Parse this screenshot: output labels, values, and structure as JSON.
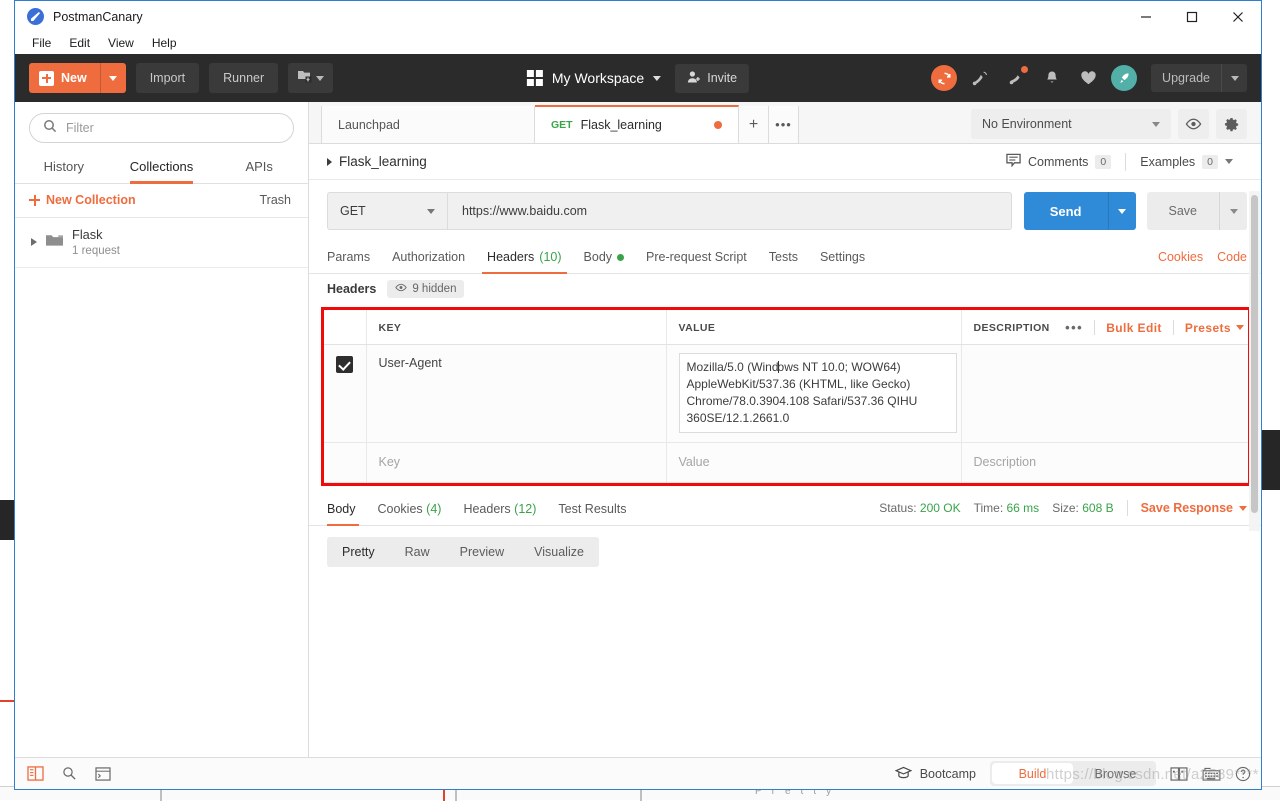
{
  "window": {
    "app_title": "PostmanCanary",
    "logo_icon": "postman-logo-icon",
    "controls": {
      "minimize": "minimize-icon",
      "maximize": "maximize-icon",
      "close": "close-icon"
    }
  },
  "menu": {
    "items": [
      "File",
      "Edit",
      "View",
      "Help"
    ]
  },
  "toolbar": {
    "new_label": "New",
    "import_label": "Import",
    "runner_label": "Runner",
    "package_icon": "new-package-icon",
    "workspace_name": "My Workspace",
    "workspace_icon": "grid-icon",
    "invite_label": "Invite",
    "invite_icon": "invite-person-icon",
    "right_icons": [
      "sync-icon",
      "satellite-icon",
      "notifications-megaphone-icon",
      "bell-icon",
      "heart-icon",
      "rocket-icon"
    ],
    "upgrade_label": "Upgrade",
    "accent_orange": "#ef6c3e",
    "teal": "#52b0a8"
  },
  "sidebar": {
    "filter_placeholder": "Filter",
    "search_icon": "search-icon",
    "tabs": [
      {
        "label": "History",
        "active": false
      },
      {
        "label": "Collections",
        "active": true
      },
      {
        "label": "APIs",
        "active": false
      }
    ],
    "new_collection_label": "New Collection",
    "trash_label": "Trash",
    "collections": [
      {
        "name": "Flask",
        "subtitle": "1 request",
        "folder_icon": "folder-icon",
        "expand_icon": "chevron-right-icon"
      }
    ]
  },
  "tabstrip": {
    "tabs": [
      {
        "label": "Launchpad",
        "method": "",
        "active": false,
        "dirty": false
      },
      {
        "label": "Flask_learning",
        "method": "GET",
        "active": true,
        "dirty": true
      }
    ],
    "new_tab_icon": "plus-icon",
    "more_tabs_icon": "ellipsis-icon",
    "environment": "No Environment",
    "eye_icon": "eye-icon",
    "settings_icon": "gear-icon"
  },
  "breadcrumb": {
    "title": "Flask_learning",
    "comments_label": "Comments",
    "comments_count": "0",
    "comments_icon": "comment-icon",
    "examples_label": "Examples",
    "examples_count": "0"
  },
  "request": {
    "method": "GET",
    "url": "https://www.baidu.com",
    "send_label": "Send",
    "save_label": "Save",
    "tabs": [
      {
        "label": "Params",
        "active": false,
        "count": "",
        "dot": false
      },
      {
        "label": "Authorization",
        "active": false,
        "count": "",
        "dot": false
      },
      {
        "label": "Headers",
        "active": true,
        "count": "(10)",
        "dot": false
      },
      {
        "label": "Body",
        "active": false,
        "count": "",
        "dot": true
      },
      {
        "label": "Pre-request Script",
        "active": false,
        "count": "",
        "dot": false
      },
      {
        "label": "Tests",
        "active": false,
        "count": "",
        "dot": false
      },
      {
        "label": "Settings",
        "active": false,
        "count": "",
        "dot": false
      }
    ],
    "cookies_link": "Cookies",
    "code_link": "Code"
  },
  "headers_section": {
    "label": "Headers",
    "hidden_pill": "9 hidden",
    "hidden_icon": "eye-icon",
    "columns": [
      "KEY",
      "VALUE",
      "DESCRIPTION"
    ],
    "more_icon": "ellipsis-icon",
    "bulk_edit_label": "Bulk Edit",
    "presets_label": "Presets",
    "rows": [
      {
        "checked": true,
        "key": "User-Agent",
        "value_line1": "Mozilla/5.0 (Wind",
        "value_line1b": "ows NT 10.0; WOW64)",
        "value_line2": "AppleWebKit/537.36 (KHTML, like Gecko)",
        "value_line3": "Chrome/78.0.3904.108 Safari/537.36 QIHU",
        "value_line4": "360SE/12.1.2661.0",
        "description": ""
      }
    ],
    "placeholder_row": {
      "key": "Key",
      "value": "Value",
      "description": "Description"
    },
    "highlight_color": "#f00a0a"
  },
  "response": {
    "tabs": [
      {
        "label": "Body",
        "count": "",
        "active": true
      },
      {
        "label": "Cookies",
        "count": "(4)",
        "active": false
      },
      {
        "label": "Headers",
        "count": "(12)",
        "active": false
      },
      {
        "label": "Test Results",
        "count": "",
        "active": false
      }
    ],
    "status_label": "Status:",
    "status_value": "200 OK",
    "time_label": "Time:",
    "time_value": "66 ms",
    "size_label": "Size:",
    "size_value": "608 B",
    "save_response_label": "Save Response",
    "format_tabs": [
      "Pretty",
      "Raw",
      "Preview",
      "Visualize"
    ],
    "active_format": "Pretty",
    "body_text": ""
  },
  "bottom_bar": {
    "left_icons": [
      "sidebar-toggle-icon",
      "find-icon",
      "console-icon"
    ],
    "bootcamp_label": "Bootcamp",
    "bootcamp_icon": "graduation-cap-icon",
    "build_label": "Build",
    "browse_label": "Browse",
    "right_icons": [
      "two-pane-layout-icon",
      "keyboard-icon",
      "help-icon"
    ]
  },
  "watermark": {
    "text": "https://blog.csdn.net/a2589****"
  }
}
